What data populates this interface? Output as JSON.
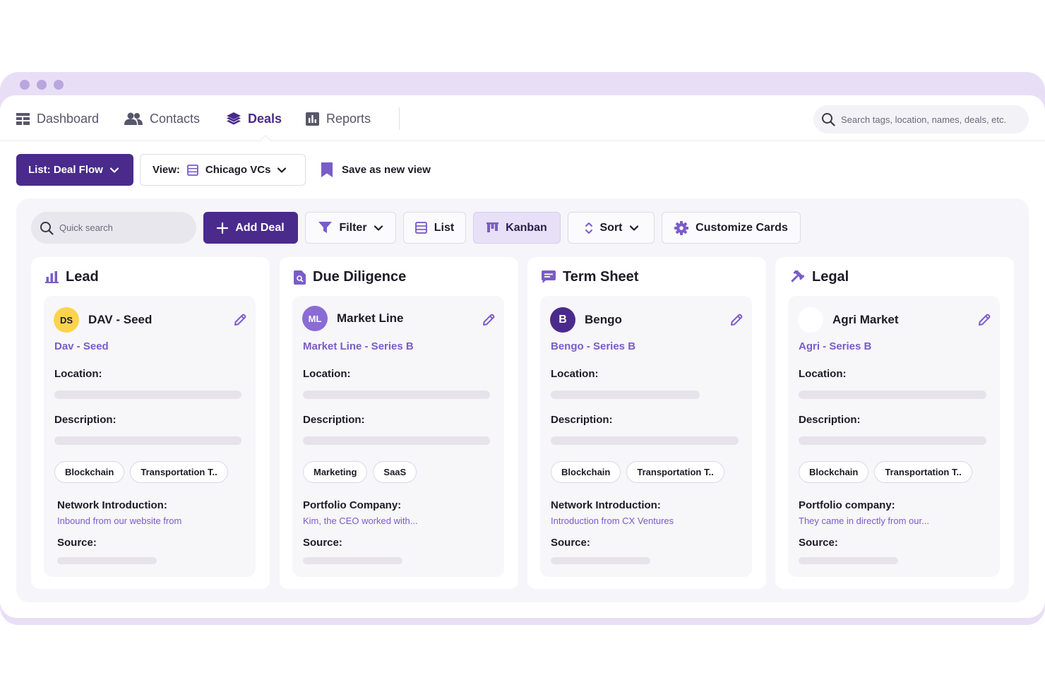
{
  "nav": {
    "items": [
      {
        "label": "Dashboard",
        "icon": "dashboard-grid-icon"
      },
      {
        "label": "Contacts",
        "icon": "contacts-people-icon"
      },
      {
        "label": "Deals",
        "icon": "deals-layers-icon",
        "active": true
      },
      {
        "label": "Reports",
        "icon": "reports-chart-icon"
      }
    ],
    "search_placeholder": "Search tags, location, names, deals, etc."
  },
  "listbar": {
    "list_label": "List: Deal Flow",
    "view_prefix": "View:",
    "view_value": "Chicago VCs",
    "save_label": "Save as new view"
  },
  "toolbar": {
    "quick_search_placeholder": "Quick search",
    "add_deal": "Add Deal",
    "filter": "Filter",
    "list": "List",
    "kanban": "Kanban",
    "sort": "Sort",
    "customize": "Customize Cards"
  },
  "columns": [
    {
      "title": "Lead",
      "icon": "bar-chart-icon",
      "card": {
        "avatar": "DS",
        "avatar_bg": "#fcd34d",
        "avatar_fg": "#1d1b26",
        "name": "DAV - Seed",
        "subtitle": "Dav - Seed",
        "location_label": "Location:",
        "description_label": "Description:",
        "tags": [
          "Blockchain",
          "Transportation T.."
        ],
        "field_label": "Network Introduction:",
        "field_value": "Inbound from our website from",
        "source_label": "Source:"
      }
    },
    {
      "title": "Due Diligence",
      "icon": "document-search-icon",
      "card": {
        "avatar": "ML",
        "avatar_bg": "#8b6bd6",
        "avatar_fg": "#ffffff",
        "name": "Market Line",
        "subtitle": "Market Line - Series B",
        "location_label": "Location:",
        "description_label": "Description:",
        "tags": [
          "Marketing",
          "SaaS"
        ],
        "field_label": "Portfolio Company:",
        "field_value": "Kim, the CEO worked with...",
        "source_label": "Source:"
      }
    },
    {
      "title": "Term Sheet",
      "icon": "message-icon",
      "card": {
        "avatar": "B",
        "avatar_bg": "#4a2b8c",
        "avatar_fg": "#ffffff",
        "name": "Bengo",
        "subtitle": "Bengo - Series B",
        "location_label": "Location:",
        "description_label": "Description:",
        "tags": [
          "Blockchain",
          "Transportation T.."
        ],
        "field_label": "Network Introduction:",
        "field_value": "Introduction from CX Ventures",
        "source_label": "Source:"
      }
    },
    {
      "title": "Legal",
      "icon": "gavel-icon",
      "card": {
        "avatar": "",
        "avatar_bg": "#ffffff",
        "avatar_fg": "#1d1b26",
        "name": "Agri Market",
        "subtitle": "Agri - Series B",
        "location_label": "Location:",
        "description_label": "Description:",
        "tags": [
          "Blockchain",
          "Transportation T.."
        ],
        "field_label": "Portfolio company:",
        "field_value": "They came in directly from our...",
        "source_label": "Source:"
      }
    }
  ],
  "colors": {
    "brand": "#4a2b8c",
    "accent": "#7a5cc8",
    "window_frame": "#e8dff6"
  }
}
